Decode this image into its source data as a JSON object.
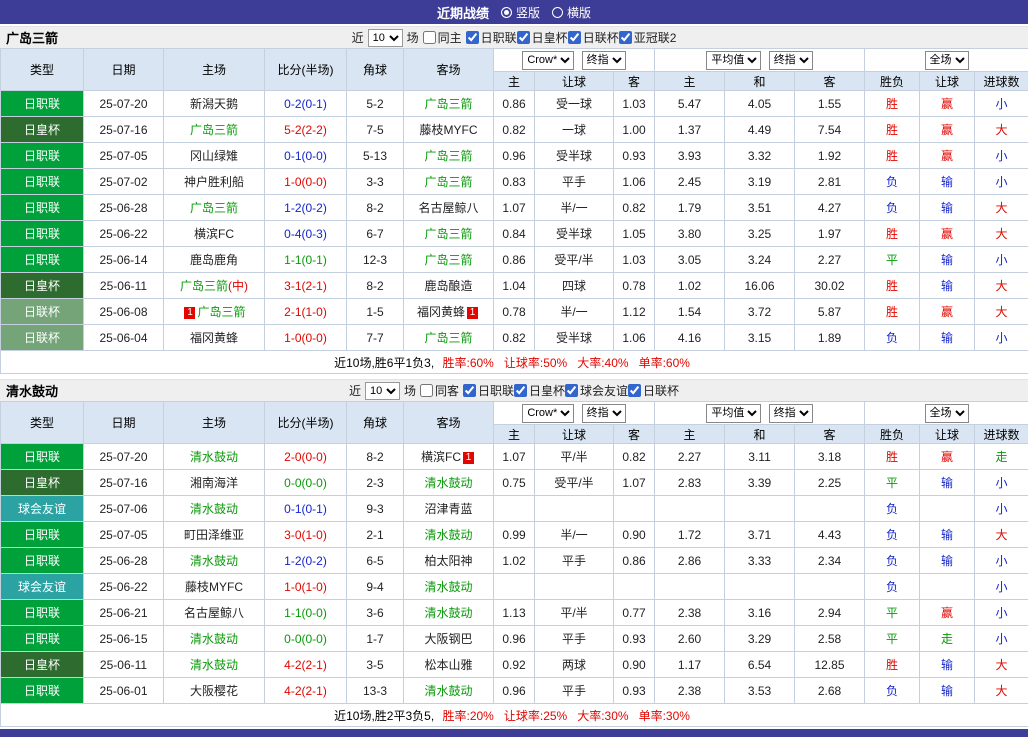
{
  "topbar": {
    "title": "近期战绩",
    "vertical": "竖版",
    "horizontal": "横版"
  },
  "sections": [
    {
      "team": "广岛三箭",
      "filter": {
        "near": "近",
        "count": "10",
        "games": "场",
        "same": "同主",
        "leagues": [
          "日职联",
          "日皇杯",
          "日联杯",
          "亚冠联2"
        ]
      },
      "selects": {
        "company": "Crow*",
        "asia_period": "终指",
        "euro_source": "平均值",
        "euro_period": "终指",
        "scope": "全场"
      },
      "columns": [
        "类型",
        "日期",
        "主场",
        "比分(半场)",
        "角球",
        "客场",
        "主",
        "让球",
        "客",
        "主",
        "和",
        "客",
        "胜负",
        "让球",
        "进球数"
      ],
      "rows": [
        {
          "league": "日职联",
          "lcls": "jl",
          "date": "25-07-20",
          "home": {
            "name": "新潟天鹅"
          },
          "score": "0-2(0-1)",
          "scls": "b",
          "corner": "5-2",
          "away": {
            "name": "广岛三箭",
            "team": true
          },
          "ah": "0.86",
          "hcap": "受一球",
          "aa": "1.03",
          "eh": "5.47",
          "ed": "4.05",
          "ea": "1.55",
          "res": "胜",
          "rcls": "r",
          "hres": "赢",
          "hrcls": "r",
          "ou": "小",
          "oucls": "b"
        },
        {
          "league": "日皇杯",
          "lcls": "ec",
          "date": "25-07-16",
          "home": {
            "name": "广岛三箭",
            "team": true
          },
          "score": "5-2(2-2)",
          "scls": "r",
          "corner": "7-5",
          "away": {
            "name": "藤枝MYFC"
          },
          "ah": "0.82",
          "hcap": "一球",
          "aa": "1.00",
          "eh": "1.37",
          "ed": "4.49",
          "ea": "7.54",
          "res": "胜",
          "rcls": "r",
          "hres": "赢",
          "hrcls": "r",
          "ou": "大",
          "oucls": "r"
        },
        {
          "league": "日职联",
          "lcls": "jl",
          "date": "25-07-05",
          "home": {
            "name": "冈山绿雉"
          },
          "score": "0-1(0-0)",
          "scls": "b",
          "corner": "5-13",
          "away": {
            "name": "广岛三箭",
            "team": true
          },
          "ah": "0.96",
          "hcap": "受半球",
          "aa": "0.93",
          "eh": "3.93",
          "ed": "3.32",
          "ea": "1.92",
          "res": "胜",
          "rcls": "r",
          "hres": "赢",
          "hrcls": "r",
          "ou": "小",
          "oucls": "b"
        },
        {
          "league": "日职联",
          "lcls": "jl",
          "date": "25-07-02",
          "home": {
            "name": "神户胜利船"
          },
          "score": "1-0(0-0)",
          "scls": "r",
          "corner": "3-3",
          "away": {
            "name": "广岛三箭",
            "team": true
          },
          "ah": "0.83",
          "hcap": "平手",
          "aa": "1.06",
          "eh": "2.45",
          "ed": "3.19",
          "ea": "2.81",
          "res": "负",
          "rcls": "b",
          "hres": "输",
          "hrcls": "b",
          "ou": "小",
          "oucls": "b"
        },
        {
          "league": "日职联",
          "lcls": "jl",
          "date": "25-06-28",
          "home": {
            "name": "广岛三箭",
            "team": true
          },
          "score": "1-2(0-2)",
          "scls": "b",
          "corner": "8-2",
          "away": {
            "name": "名古屋鲸八"
          },
          "ah": "1.07",
          "hcap": "半/一",
          "aa": "0.82",
          "eh": "1.79",
          "ed": "3.51",
          "ea": "4.27",
          "res": "负",
          "rcls": "b",
          "hres": "输",
          "hrcls": "b",
          "ou": "大",
          "oucls": "r"
        },
        {
          "league": "日职联",
          "lcls": "jl",
          "date": "25-06-22",
          "home": {
            "name": "横滨FC"
          },
          "score": "0-4(0-3)",
          "scls": "b",
          "corner": "6-7",
          "away": {
            "name": "广岛三箭",
            "team": true
          },
          "ah": "0.84",
          "hcap": "受半球",
          "aa": "1.05",
          "eh": "3.80",
          "ed": "3.25",
          "ea": "1.97",
          "res": "胜",
          "rcls": "r",
          "hres": "赢",
          "hrcls": "r",
          "ou": "大",
          "oucls": "r"
        },
        {
          "league": "日职联",
          "lcls": "jl",
          "date": "25-06-14",
          "home": {
            "name": "鹿岛鹿角"
          },
          "score": "1-1(0-1)",
          "scls": "g",
          "corner": "12-3",
          "away": {
            "name": "广岛三箭",
            "team": true
          },
          "ah": "0.86",
          "hcap": "受平/半",
          "aa": "1.03",
          "eh": "3.05",
          "ed": "3.24",
          "ea": "2.27",
          "res": "平",
          "rcls": "g",
          "hres": "输",
          "hrcls": "b",
          "ou": "小",
          "oucls": "b"
        },
        {
          "league": "日皇杯",
          "lcls": "ec",
          "date": "25-06-11",
          "home": {
            "name": "广岛三箭",
            "team": true,
            "suffix": "(中)"
          },
          "score": "3-1(2-1)",
          "scls": "r",
          "corner": "8-2",
          "away": {
            "name": "鹿岛酿造"
          },
          "ah": "1.04",
          "hcap": "四球",
          "aa": "0.78",
          "eh": "1.02",
          "ed": "16.06",
          "ea": "30.02",
          "res": "胜",
          "rcls": "r",
          "hres": "输",
          "hrcls": "b",
          "ou": "大",
          "oucls": "r"
        },
        {
          "league": "日联杯",
          "lcls": "lc",
          "date": "25-06-08",
          "home": {
            "name": "广岛三箭",
            "team": true,
            "badge": "1",
            "badge_pos": "pre"
          },
          "score": "2-1(1-0)",
          "scls": "r",
          "corner": "1-5",
          "away": {
            "name": "福冈黄蜂",
            "badge": "1",
            "badge_pos": "post"
          },
          "ah": "0.78",
          "hcap": "半/一",
          "aa": "1.12",
          "eh": "1.54",
          "ed": "3.72",
          "ea": "5.87",
          "res": "胜",
          "rcls": "r",
          "hres": "赢",
          "hrcls": "r",
          "ou": "大",
          "oucls": "r"
        },
        {
          "league": "日联杯",
          "lcls": "lc",
          "date": "25-06-04",
          "home": {
            "name": "福冈黄蜂"
          },
          "score": "1-0(0-0)",
          "scls": "r",
          "corner": "7-7",
          "away": {
            "name": "广岛三箭",
            "team": true
          },
          "ah": "0.82",
          "hcap": "受半球",
          "aa": "1.06",
          "eh": "4.16",
          "ed": "3.15",
          "ea": "1.89",
          "res": "负",
          "rcls": "b",
          "hres": "输",
          "hrcls": "b",
          "ou": "小",
          "oucls": "b"
        }
      ],
      "summary": {
        "prefix": "近10场,胜6平1负3,",
        "stats": [
          "胜率:60%",
          "让球率:50%",
          "大率:40%",
          "单率:60%"
        ]
      }
    },
    {
      "team": "清水鼓动",
      "filter": {
        "near": "近",
        "count": "10",
        "games": "场",
        "same": "同客",
        "leagues": [
          "日职联",
          "日皇杯",
          "球会友谊",
          "日联杯"
        ]
      },
      "selects": {
        "company": "Crow*",
        "asia_period": "终指",
        "euro_source": "平均值",
        "euro_period": "终指",
        "scope": "全场"
      },
      "columns": [
        "类型",
        "日期",
        "主场",
        "比分(半场)",
        "角球",
        "客场",
        "主",
        "让球",
        "客",
        "主",
        "和",
        "客",
        "胜负",
        "让球",
        "进球数"
      ],
      "rows": [
        {
          "league": "日职联",
          "lcls": "jl",
          "date": "25-07-20",
          "home": {
            "name": "清水鼓动",
            "team": true
          },
          "score": "2-0(0-0)",
          "scls": "r",
          "corner": "8-2",
          "away": {
            "name": "横滨FC",
            "badge": "1",
            "badge_pos": "post"
          },
          "ah": "1.07",
          "hcap": "平/半",
          "aa": "0.82",
          "eh": "2.27",
          "ed": "3.11",
          "ea": "3.18",
          "res": "胜",
          "rcls": "r",
          "hres": "赢",
          "hrcls": "r",
          "ou": "走",
          "oucls": "g"
        },
        {
          "league": "日皇杯",
          "lcls": "ec",
          "date": "25-07-16",
          "home": {
            "name": "湘南海洋"
          },
          "score": "0-0(0-0)",
          "scls": "g",
          "corner": "2-3",
          "away": {
            "name": "清水鼓动",
            "team": true
          },
          "ah": "0.75",
          "hcap": "受平/半",
          "aa": "1.07",
          "eh": "2.83",
          "ed": "3.39",
          "ea": "2.25",
          "res": "平",
          "rcls": "g",
          "hres": "输",
          "hrcls": "b",
          "ou": "小",
          "oucls": "b"
        },
        {
          "league": "球会友谊",
          "lcls": "fr",
          "date": "25-07-06",
          "home": {
            "name": "清水鼓动",
            "team": true
          },
          "score": "0-1(0-1)",
          "scls": "b",
          "corner": "9-3",
          "away": {
            "name": "沼津青蓝"
          },
          "ah": "",
          "hcap": "",
          "aa": "",
          "eh": "",
          "ed": "",
          "ea": "",
          "res": "负",
          "rcls": "b",
          "hres": "",
          "hrcls": "",
          "ou": "小",
          "oucls": "b"
        },
        {
          "league": "日职联",
          "lcls": "jl",
          "date": "25-07-05",
          "home": {
            "name": "町田泽维亚"
          },
          "score": "3-0(1-0)",
          "scls": "r",
          "corner": "2-1",
          "away": {
            "name": "清水鼓动",
            "team": true
          },
          "ah": "0.99",
          "hcap": "半/一",
          "aa": "0.90",
          "eh": "1.72",
          "ed": "3.71",
          "ea": "4.43",
          "res": "负",
          "rcls": "b",
          "hres": "输",
          "hrcls": "b",
          "ou": "大",
          "oucls": "r"
        },
        {
          "league": "日职联",
          "lcls": "jl",
          "date": "25-06-28",
          "home": {
            "name": "清水鼓动",
            "team": true
          },
          "score": "1-2(0-2)",
          "scls": "b",
          "corner": "6-5",
          "away": {
            "name": "柏太阳神"
          },
          "ah": "1.02",
          "hcap": "平手",
          "aa": "0.86",
          "eh": "2.86",
          "ed": "3.33",
          "ea": "2.34",
          "res": "负",
          "rcls": "b",
          "hres": "输",
          "hrcls": "b",
          "ou": "小",
          "oucls": "b"
        },
        {
          "league": "球会友谊",
          "lcls": "fr",
          "date": "25-06-22",
          "home": {
            "name": "藤枝MYFC"
          },
          "score": "1-0(1-0)",
          "scls": "r",
          "corner": "9-4",
          "away": {
            "name": "清水鼓动",
            "team": true
          },
          "ah": "",
          "hcap": "",
          "aa": "",
          "eh": "",
          "ed": "",
          "ea": "",
          "res": "负",
          "rcls": "b",
          "hres": "",
          "hrcls": "",
          "ou": "小",
          "oucls": "b"
        },
        {
          "league": "日职联",
          "lcls": "jl",
          "date": "25-06-21",
          "home": {
            "name": "名古屋鲸八"
          },
          "score": "1-1(0-0)",
          "scls": "g",
          "corner": "3-6",
          "away": {
            "name": "清水鼓动",
            "team": true
          },
          "ah": "1.13",
          "hcap": "平/半",
          "aa": "0.77",
          "eh": "2.38",
          "ed": "3.16",
          "ea": "2.94",
          "res": "平",
          "rcls": "g",
          "hres": "赢",
          "hrcls": "r",
          "ou": "小",
          "oucls": "b"
        },
        {
          "league": "日职联",
          "lcls": "jl",
          "date": "25-06-15",
          "home": {
            "name": "清水鼓动",
            "team": true
          },
          "score": "0-0(0-0)",
          "scls": "g",
          "corner": "1-7",
          "away": {
            "name": "大阪钢巴"
          },
          "ah": "0.96",
          "hcap": "平手",
          "aa": "0.93",
          "eh": "2.60",
          "ed": "3.29",
          "ea": "2.58",
          "res": "平",
          "rcls": "g",
          "hres": "走",
          "hrcls": "g",
          "ou": "小",
          "oucls": "b"
        },
        {
          "league": "日皇杯",
          "lcls": "ec",
          "date": "25-06-11",
          "home": {
            "name": "清水鼓动",
            "team": true
          },
          "score": "4-2(2-1)",
          "scls": "r",
          "corner": "3-5",
          "away": {
            "name": "松本山雅"
          },
          "ah": "0.92",
          "hcap": "两球",
          "aa": "0.90",
          "eh": "1.17",
          "ed": "6.54",
          "ea": "12.85",
          "res": "胜",
          "rcls": "r",
          "hres": "输",
          "hrcls": "b",
          "ou": "大",
          "oucls": "r"
        },
        {
          "league": "日职联",
          "lcls": "jl",
          "date": "25-06-01",
          "home": {
            "name": "大阪樱花"
          },
          "score": "4-2(2-1)",
          "scls": "r",
          "corner": "13-3",
          "away": {
            "name": "清水鼓动",
            "team": true
          },
          "ah": "0.96",
          "hcap": "平手",
          "aa": "0.93",
          "eh": "2.38",
          "ed": "3.53",
          "ea": "2.68",
          "res": "负",
          "rcls": "b",
          "hres": "输",
          "hrcls": "b",
          "ou": "大",
          "oucls": "r"
        }
      ],
      "summary": {
        "prefix": "近10场,胜2平3负5,",
        "stats": [
          "胜率:20%",
          "让球率:25%",
          "大率:30%",
          "单率:30%"
        ]
      }
    }
  ]
}
